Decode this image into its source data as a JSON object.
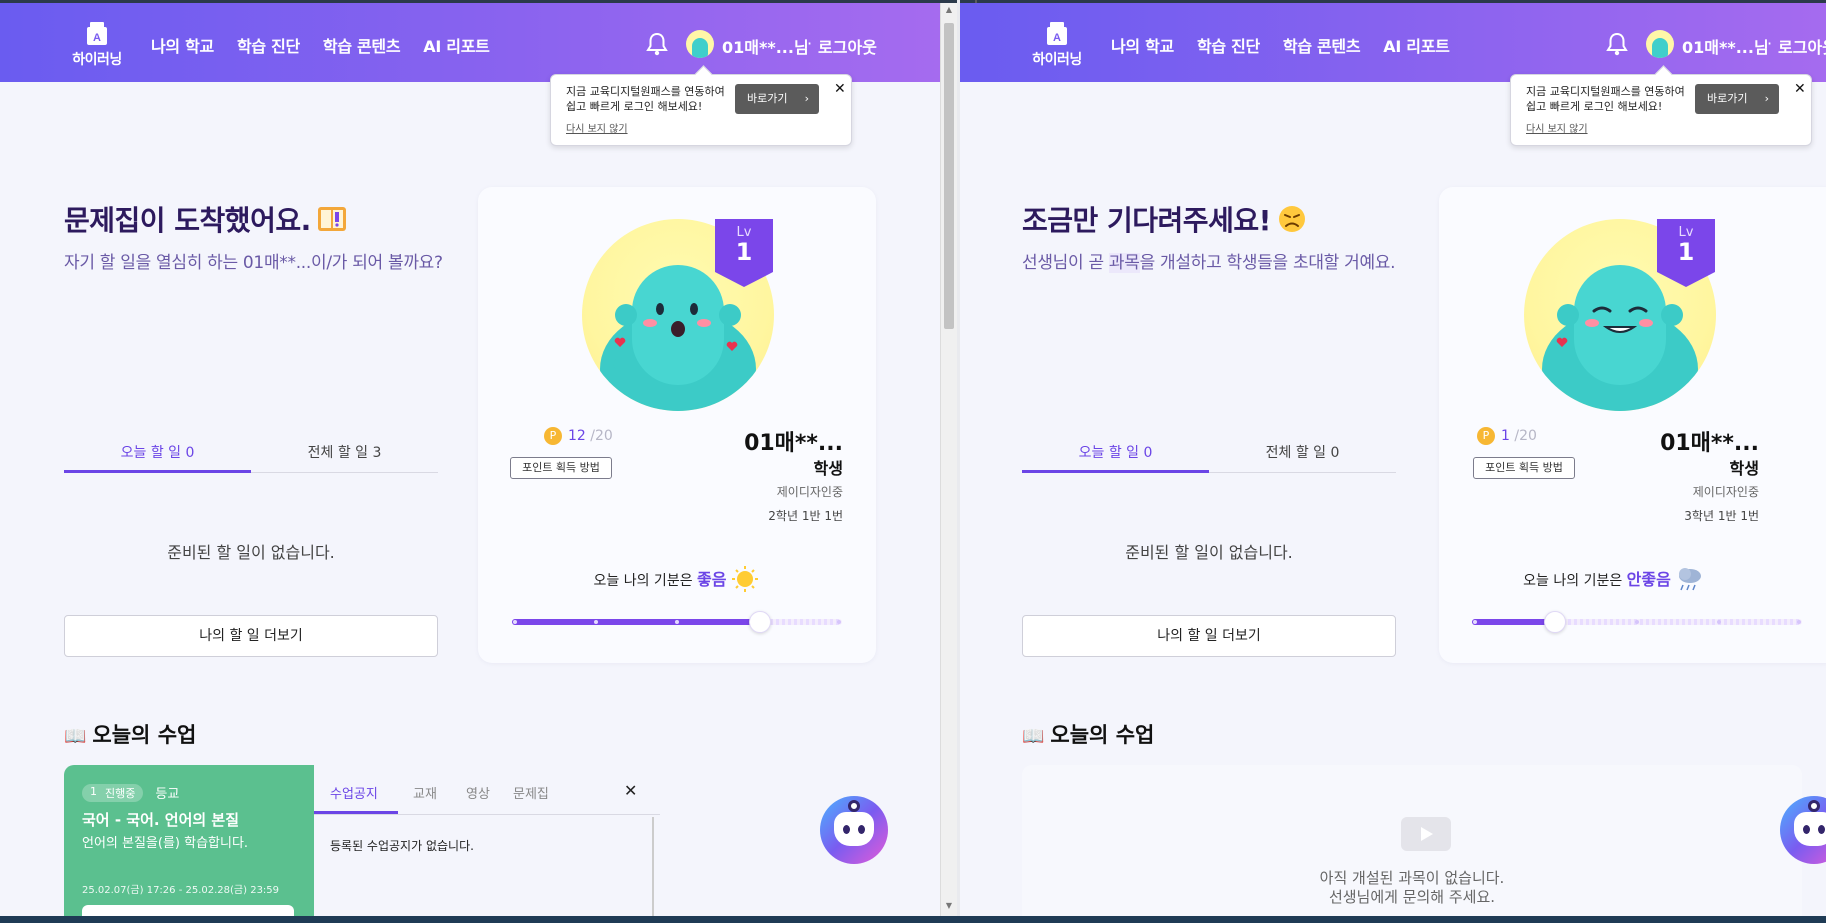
{
  "left": {
    "logo_text": "하이러닝",
    "nav": [
      "나의 학교",
      "학습 진단",
      "학습 콘텐츠",
      "AI 리포트"
    ],
    "user_name": "01매**...님",
    "logout": "로그아웃",
    "popup": {
      "text": "지금 교육디지털원패스를 연동하여 쉽고 빠르게 로그인 해보세요!",
      "button": "바로가기",
      "dismiss": "다시 보지 않기"
    },
    "hero": {
      "title": "문제집이 도착했어요.",
      "subtitle": "자기 할 일을 열심히 하는 01매**...이/가 되어 볼까요?"
    },
    "tabs": {
      "today": "오늘 할 일 0",
      "all": "전체 할 일 3"
    },
    "empty_todo": "준비된 할 일이 없습니다.",
    "more_button": "나의 할 일 더보기",
    "profile": {
      "lv_label": "Lv",
      "level": "1",
      "points": "12",
      "points_max": "/20",
      "point_button": "포인트 획득 방법",
      "name": "01매**...",
      "role": "학생",
      "school": "제이디자인중",
      "class": "2학년 1반 1번",
      "mood_prefix": "오늘 나의 기분은",
      "mood_value": "좋음",
      "mood_level": 0.75
    },
    "lesson_section_title": "오늘의 수업",
    "lesson": {
      "order": "1",
      "status": "진행중",
      "type": "등교",
      "title": "국어 - 국어. 언어의 본질",
      "desc": "언어의 본질을(를) 학습합니다.",
      "date": "25.02.07(금) 17:26 - 25.02.28(금) 23:59"
    },
    "lesson_tabs": [
      "수업공지",
      "교재",
      "영상",
      "문제집"
    ],
    "lesson_empty": "등록된 수업공지가 없습니다."
  },
  "right": {
    "logo_text": "하이러닝",
    "nav": [
      "나의 학교",
      "학습 진단",
      "학습 콘텐츠",
      "AI 리포트"
    ],
    "user_name": "01매**...님",
    "logout": "로그아웃",
    "popup": {
      "text": "지금 교육디지털원패스를 연동하여 쉽고 빠르게 로그인 해보세요!",
      "button": "바로가기",
      "dismiss": "다시 보지 않기"
    },
    "hero": {
      "title": "조금만 기다려주세요!",
      "subtitle_pre": "선생님이 곧 ",
      "subtitle_hl": "과목",
      "subtitle_post": "을 개설하고 학생들을 초대할 거예요."
    },
    "tabs": {
      "today": "오늘 할 일 0",
      "all": "전체 할 일 0"
    },
    "empty_todo": "준비된 할 일이 없습니다.",
    "more_button": "나의 할 일 더보기",
    "profile": {
      "lv_label": "Lv",
      "level": "1",
      "points": "1",
      "points_max": "/20",
      "point_button": "포인트 획득 방법",
      "name": "01매**...",
      "role": "학생",
      "school": "제이디자인중",
      "class": "3학년 1반 1번",
      "mood_prefix": "오늘 나의 기분은",
      "mood_value": "안좋음",
      "mood_level": 0.25
    },
    "lesson_section_title": "오늘의 수업",
    "nolesson_line1": "아직 개설된 과목이 없습니다.",
    "nolesson_line2": "선생님에게 문의해 주세요."
  },
  "colors": {
    "accent": "#6b45e6",
    "header_start": "#6a5cf0",
    "header_end": "#a56bef",
    "lesson_green": "#5bc08f"
  }
}
